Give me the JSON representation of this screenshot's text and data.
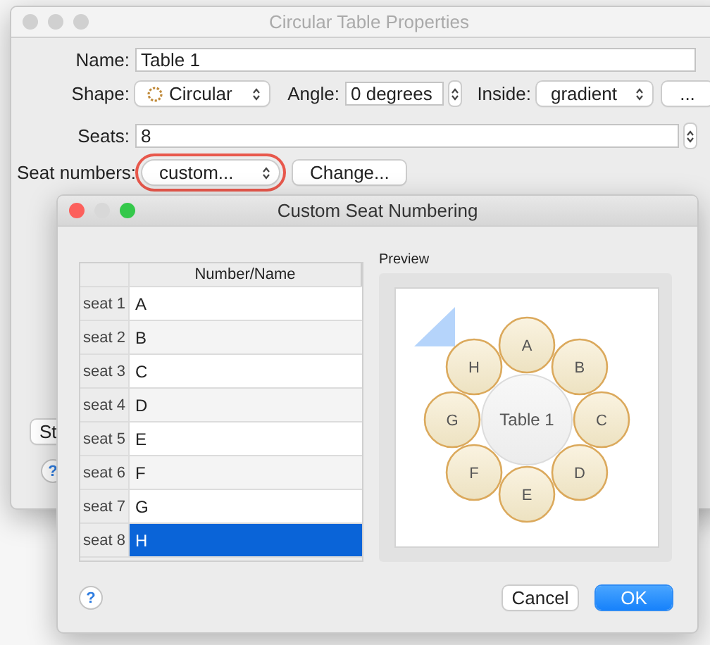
{
  "main_window": {
    "title": "Circular Table Properties",
    "active": false,
    "name": {
      "label": "Name:",
      "value": "Table 1"
    },
    "shape": {
      "label": "Shape:",
      "value": "Circular"
    },
    "angle": {
      "label": "Angle:",
      "value": "0 degrees"
    },
    "inside": {
      "label": "Inside:",
      "value": "gradient"
    },
    "more_button": "...",
    "seats": {
      "label": "Seats:",
      "value": "8"
    },
    "seat_numbers": {
      "label": "Seat numbers:",
      "value": "custom...",
      "highlighted": true
    },
    "change_button": "Change...",
    "partial_button": "St",
    "help": "?"
  },
  "dialog": {
    "title": "Custom Seat Numbering",
    "active": true,
    "table": {
      "columns": [
        "Number/Name"
      ],
      "rows": [
        {
          "seat": "seat 1",
          "name": "A",
          "selected": false
        },
        {
          "seat": "seat 2",
          "name": "B",
          "selected": false
        },
        {
          "seat": "seat 3",
          "name": "C",
          "selected": false
        },
        {
          "seat": "seat 4",
          "name": "D",
          "selected": false
        },
        {
          "seat": "seat 5",
          "name": "E",
          "selected": false
        },
        {
          "seat": "seat 6",
          "name": "F",
          "selected": false
        },
        {
          "seat": "seat 7",
          "name": "G",
          "selected": false
        },
        {
          "seat": "seat 8",
          "name": "H",
          "selected": true
        }
      ]
    },
    "preview": {
      "label": "Preview",
      "table_label": "Table 1",
      "seats": [
        "A",
        "B",
        "C",
        "D",
        "E",
        "F",
        "G",
        "H"
      ]
    },
    "help": "?",
    "buttons": [
      {
        "label": "Cancel",
        "kind": "secondary"
      },
      {
        "label": "OK",
        "kind": "primary"
      }
    ]
  }
}
